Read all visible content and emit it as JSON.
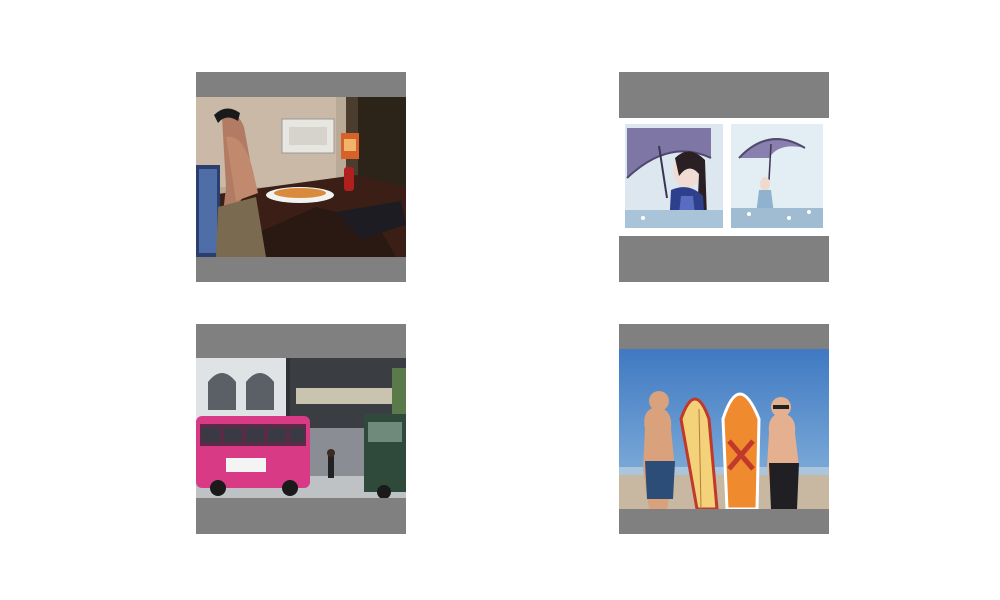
{
  "images": [
    {
      "name": "office-desk-feet-photo"
    },
    {
      "name": "umbrella-woman-diptych-photo"
    },
    {
      "name": "pink-bus-street-photo"
    },
    {
      "name": "surfers-with-boards-photo"
    }
  ]
}
